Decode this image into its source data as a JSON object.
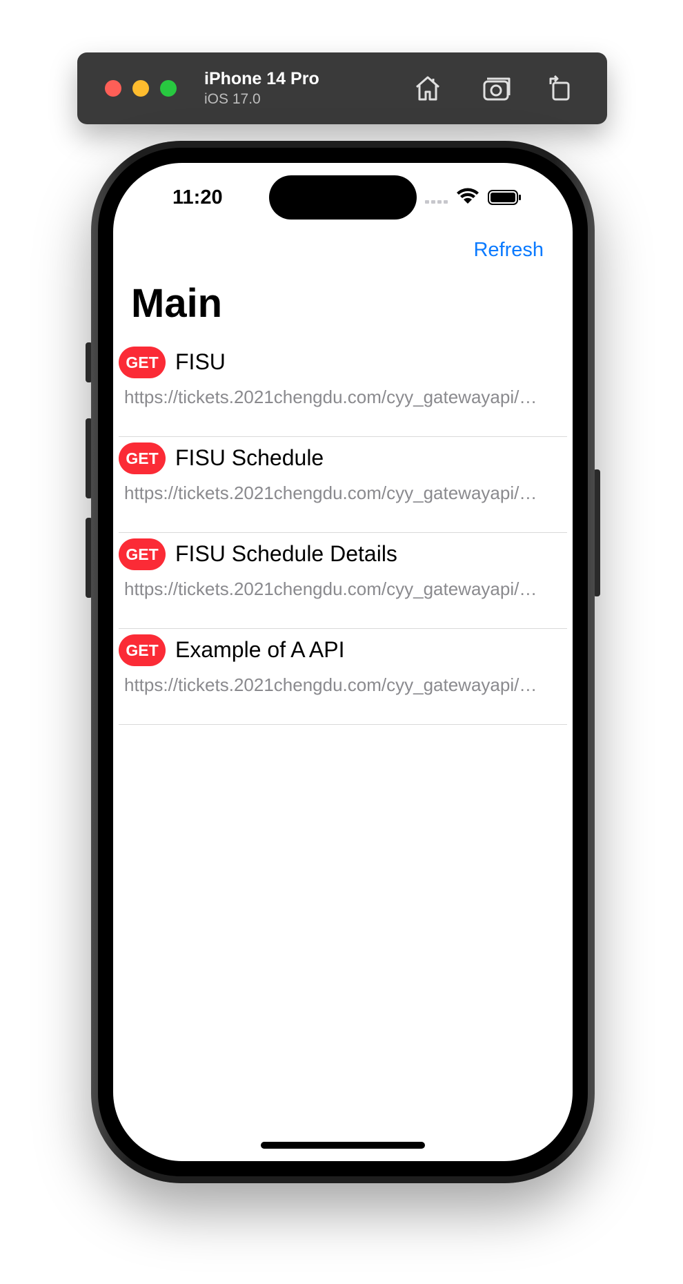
{
  "simulator": {
    "device_name": "iPhone 14 Pro",
    "os_version": "iOS 17.0",
    "toolbar_icons": [
      "home-icon",
      "screenshot-icon",
      "rotate-icon"
    ]
  },
  "status_bar": {
    "time": "11:20",
    "icons": [
      "cellular-icon",
      "wifi-icon",
      "battery-icon"
    ]
  },
  "nav": {
    "refresh_label": "Refresh",
    "title": "Main"
  },
  "requests": [
    {
      "method": "GET",
      "name": "FISU",
      "url": "https://tickets.2021chengdu.com/cyy_gatewayapi/…"
    },
    {
      "method": "GET",
      "name": "FISU Schedule",
      "url": "https://tickets.2021chengdu.com/cyy_gatewayapi/…"
    },
    {
      "method": "GET",
      "name": "FISU Schedule Details",
      "url": "https://tickets.2021chengdu.com/cyy_gatewayapi/…"
    },
    {
      "method": "GET",
      "name": "Example of A API",
      "url": "https://tickets.2021chengdu.com/cyy_gatewayapi/…"
    }
  ],
  "colors": {
    "accent": "#0a7aff",
    "method_get": "#fb2b36"
  }
}
